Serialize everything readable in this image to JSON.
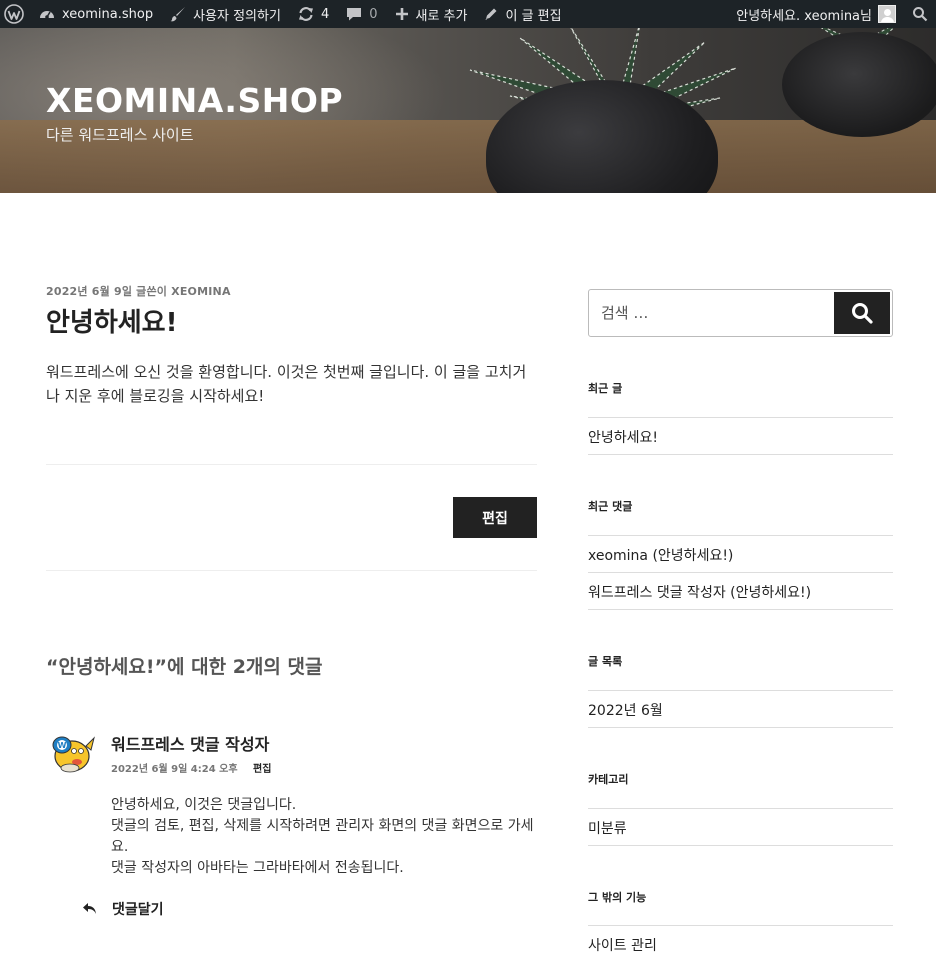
{
  "adminbar": {
    "site": "xeomina.shop",
    "customize": "사용자 정의하기",
    "updates": "4",
    "comments": "0",
    "new": "새로 추가",
    "edit_post": "이 글 편집",
    "greeting": "안녕하세요. xeomina님"
  },
  "header": {
    "title": "XEOMINA.SHOP",
    "description": "다른 워드프레스 사이트"
  },
  "post": {
    "meta": "2022년 6월 9일 글쓴이 XEOMINA",
    "title": "안녕하세요!",
    "content": "워드프레스에 오신 것을 환영합니다. 이것은 첫번째 글입니다. 이 글을 고치거나 지운 후에 블로깅을 시작하세요!",
    "edit_label": "편집"
  },
  "comments": {
    "title": "“안녕하세요!”에 대한 2개의 댓글",
    "items": [
      {
        "author": "워드프레스 댓글 작성자",
        "date": "2022년 6월 9일 4:24 오후",
        "edit": "편집",
        "lines": [
          "안녕하세요, 이것은 댓글입니다.",
          "댓글의 검토, 편집, 삭제를 시작하려면 관리자 화면의 댓글 화면으로 가세요.",
          "댓글 작성자의 아바타는 그라바타에서 전송됩니다."
        ],
        "reply": "댓글달기"
      }
    ]
  },
  "sidebar": {
    "search_placeholder": "검색 …",
    "recent_posts": {
      "title": "최근 글",
      "items": [
        "안녕하세요!"
      ]
    },
    "recent_comments": {
      "title": "최근 댓글",
      "items": [
        "xeomina (안녕하세요!)",
        "워드프레스 댓글 작성자 (안녕하세요!)"
      ]
    },
    "archives": {
      "title": "글 목록",
      "items": [
        "2022년 6월"
      ]
    },
    "categories": {
      "title": "카테고리",
      "items": [
        "미분류"
      ]
    },
    "meta": {
      "title": "그 밖의 기능",
      "items": [
        "사이트 관리"
      ]
    }
  }
}
